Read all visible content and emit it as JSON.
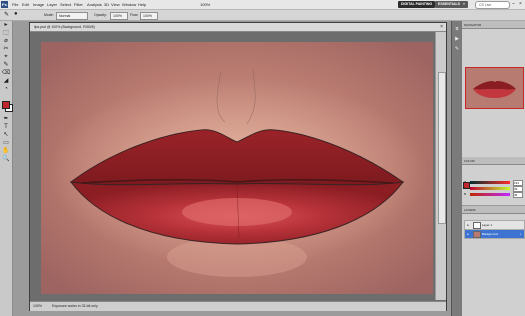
{
  "menubar": {
    "logo": "Ps",
    "items": [
      "File",
      "Edit",
      "Image",
      "Layer",
      "Select",
      "Filter",
      "Analysis",
      "3D",
      "View",
      "Window",
      "Help"
    ],
    "zoom": "100%",
    "workspace_digital": "DIGITAL PAINTING",
    "workspace_essentials": "ESSENTIALS",
    "workspace_more": "»",
    "search_placeholder": "CS Live",
    "minimize": "–",
    "maximize": "□",
    "close": "×"
  },
  "options": {
    "mode_label": "Mode:",
    "mode_value": "Normal",
    "opacity_label": "Opacity:",
    "opacity_value": "100%",
    "flow_label": "Flow:",
    "flow_value": "100%"
  },
  "tools": [
    "▸",
    "⬚",
    "⌀",
    "✂",
    "⌖",
    "✎",
    "⌫",
    "◢",
    "◔",
    "✒",
    "T",
    "↖",
    "▭",
    "✋",
    "🔍"
  ],
  "document": {
    "title": "lips.psd @ 100% (Background, RGB/8)",
    "close": "×",
    "status_zoom": "100%",
    "status_info": "Exposure works in 32-bit only"
  },
  "panels": {
    "navigator_tab": "NAVIGATOR",
    "color_tab": "COLOR",
    "r_label": "R",
    "g_label": "G",
    "b_label": "B",
    "r_value": "191",
    "g_value": "39",
    "b_value": "45",
    "layers_tab": "LAYERS",
    "layers": [
      {
        "name": "Layer 1",
        "active": false
      },
      {
        "name": "Background",
        "active": true
      }
    ]
  },
  "colors": {
    "foreground": "#c0272d",
    "background": "#ffffff",
    "accent_blue": "#3d74d1",
    "skin": "#b5756d",
    "lip_dark": "#8e1f24"
  },
  "icons": {
    "eye": "eye-icon",
    "lock": "lock-icon"
  }
}
